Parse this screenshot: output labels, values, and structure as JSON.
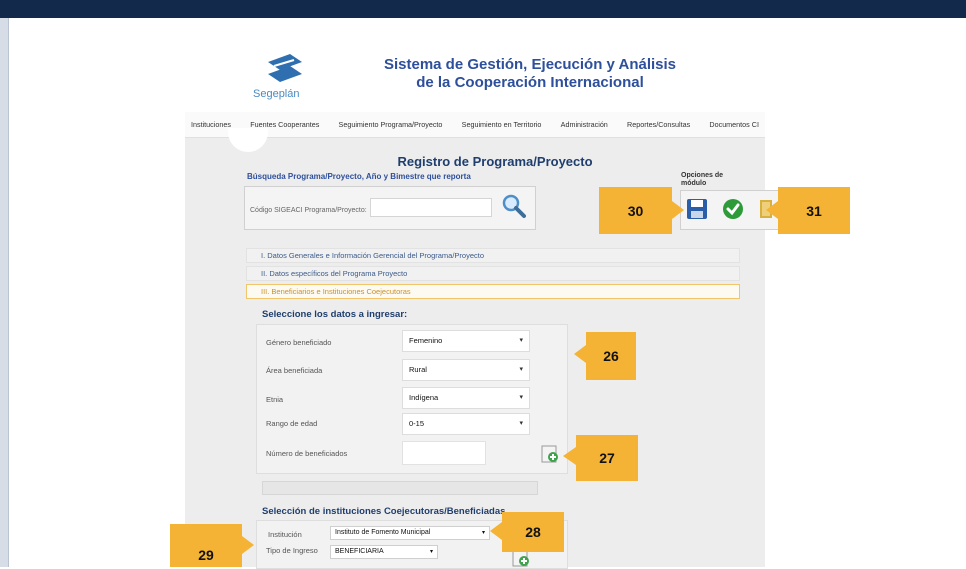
{
  "header": {
    "logo_text": "Segeplán",
    "title_line1": "Sistema de Gestión, Ejecución y Análisis",
    "title_line2": "de la Cooperación Internacional"
  },
  "menu": [
    "Instituciones",
    "Fuentes Cooperantes",
    "Seguimiento Programa/Proyecto",
    "Seguimiento en Territorio",
    "Administración",
    "Reportes/Consultas",
    "Documentos CI"
  ],
  "page": {
    "title": "Registro de Programa/Proyecto",
    "search_label": "Búsqueda Programa/Proyecto, Año y Bimestre que reporta",
    "code_label": "Código SIGEACI Programa/Proyecto:",
    "code_value": "",
    "options_label_1": "Opciones de",
    "options_label_2": "módulo"
  },
  "accordion": [
    "I. Datos Generales e Información Gerencial del Programa/Proyecto",
    "II. Datos específicos del Programa Proyecto",
    "III. Beneficiarios e Instituciones Coejecutoras"
  ],
  "beneficiaries": {
    "section_title": "Seleccione los datos a ingresar:",
    "fields": [
      {
        "label": "Género beneficiado",
        "value": "Femenino"
      },
      {
        "label": "Área beneficiada",
        "value": "Rural"
      },
      {
        "label": "Etnia",
        "value": "Indígena"
      },
      {
        "label": "Rango de edad",
        "value": "0-15"
      }
    ],
    "count_label": "Número de beneficiados",
    "count_value": ""
  },
  "institutions": {
    "section_title": "Selección de instituciones Coejecutoras/Beneficiadas",
    "inst_label": "Institución",
    "inst_value": "Instituto de Fomento Municipal",
    "type_label": "Tipo de Ingreso",
    "type_value": "BENEFICIARIA"
  },
  "callouts": [
    "26",
    "27",
    "28",
    "29",
    "30",
    "31"
  ],
  "colors": {
    "callout": "#f5b335",
    "topbar": "#13294b",
    "title": "#2d4f9c",
    "active_section": "#c9902c"
  }
}
